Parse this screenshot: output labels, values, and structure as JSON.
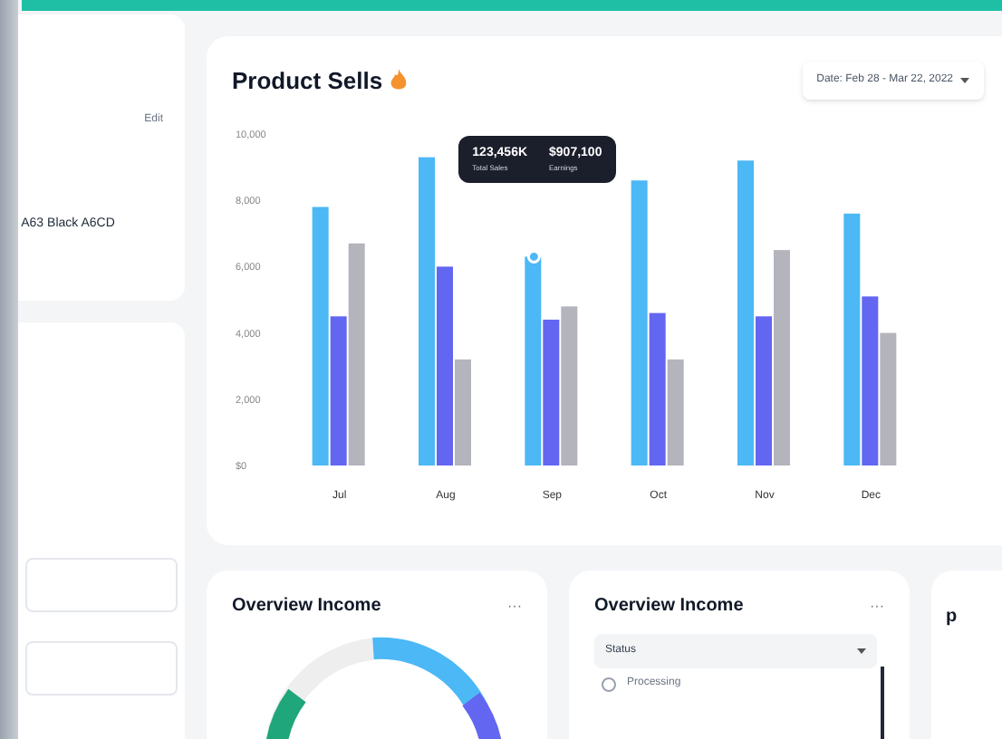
{
  "profile_card": {
    "edit": "Edit",
    "text": "A63 Black A6CD"
  },
  "product_sells": {
    "title": "Product Sells",
    "date_filter": "Date: Feb 28 - Mar 22, 2022",
    "chart_data": {
      "type": "bar",
      "categories": [
        "Jul",
        "Aug",
        "Sep",
        "Oct",
        "Nov",
        "Dec"
      ],
      "ylim": [
        0,
        10000
      ],
      "yticks": [
        {
          "value": 0,
          "label": "$0"
        },
        {
          "value": 2000,
          "label": "2,000"
        },
        {
          "value": 4000,
          "label": "4,000"
        },
        {
          "value": 6000,
          "label": "6,000"
        },
        {
          "value": 8000,
          "label": "8,000"
        },
        {
          "value": 10000,
          "label": "10,000"
        }
      ],
      "series": [
        {
          "color": "#4cb8f5",
          "values": [
            7800,
            9300,
            6300,
            8600,
            9200,
            7600
          ]
        },
        {
          "color": "#6366f1",
          "values": [
            4500,
            6000,
            4400,
            4600,
            4500,
            5100
          ]
        },
        {
          "color": "#b4b4bd",
          "values": [
            6700,
            3200,
            4800,
            3200,
            6500,
            4000
          ]
        }
      ]
    },
    "tooltip": {
      "items": [
        {
          "value": "123,456K",
          "label": "Total Sales"
        },
        {
          "value": "$907,100",
          "label": "Earnings"
        }
      ]
    }
  },
  "overview_cards": [
    {
      "kind": "donut",
      "title": "Overview Income",
      "menu": "···"
    },
    {
      "kind": "filter",
      "title": "Overview Income",
      "menu": "···",
      "dropdown": "Status",
      "options": [
        {
          "label": "Processing",
          "checked": false
        }
      ]
    }
  ],
  "partial_card": {
    "title": "p"
  }
}
